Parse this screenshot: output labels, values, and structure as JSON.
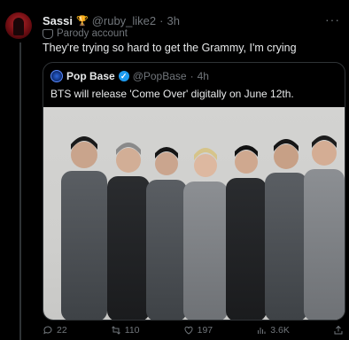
{
  "post": {
    "author_name": "Sassi",
    "author_badge_icon": "trophy-icon",
    "author_handle": "@ruby_like2",
    "separator": "·",
    "time": "3h",
    "parody_label": "Parody account",
    "text": "They're trying so hard to get the Grammy, I'm crying"
  },
  "quote": {
    "author_name": "Pop Base",
    "author_handle": "@PopBase",
    "separator": "·",
    "time": "4h",
    "text": "BTS will release 'Come Over' digitally on June 12th.",
    "verified_color": "#1d9bf0"
  },
  "actions": {
    "replies": "22",
    "reposts": "110",
    "likes": "197",
    "views": "3.6K"
  },
  "colors": {
    "background": "#000000",
    "text_primary": "#e7e9ea",
    "text_secondary": "#71767b",
    "border": "#2f3336"
  }
}
